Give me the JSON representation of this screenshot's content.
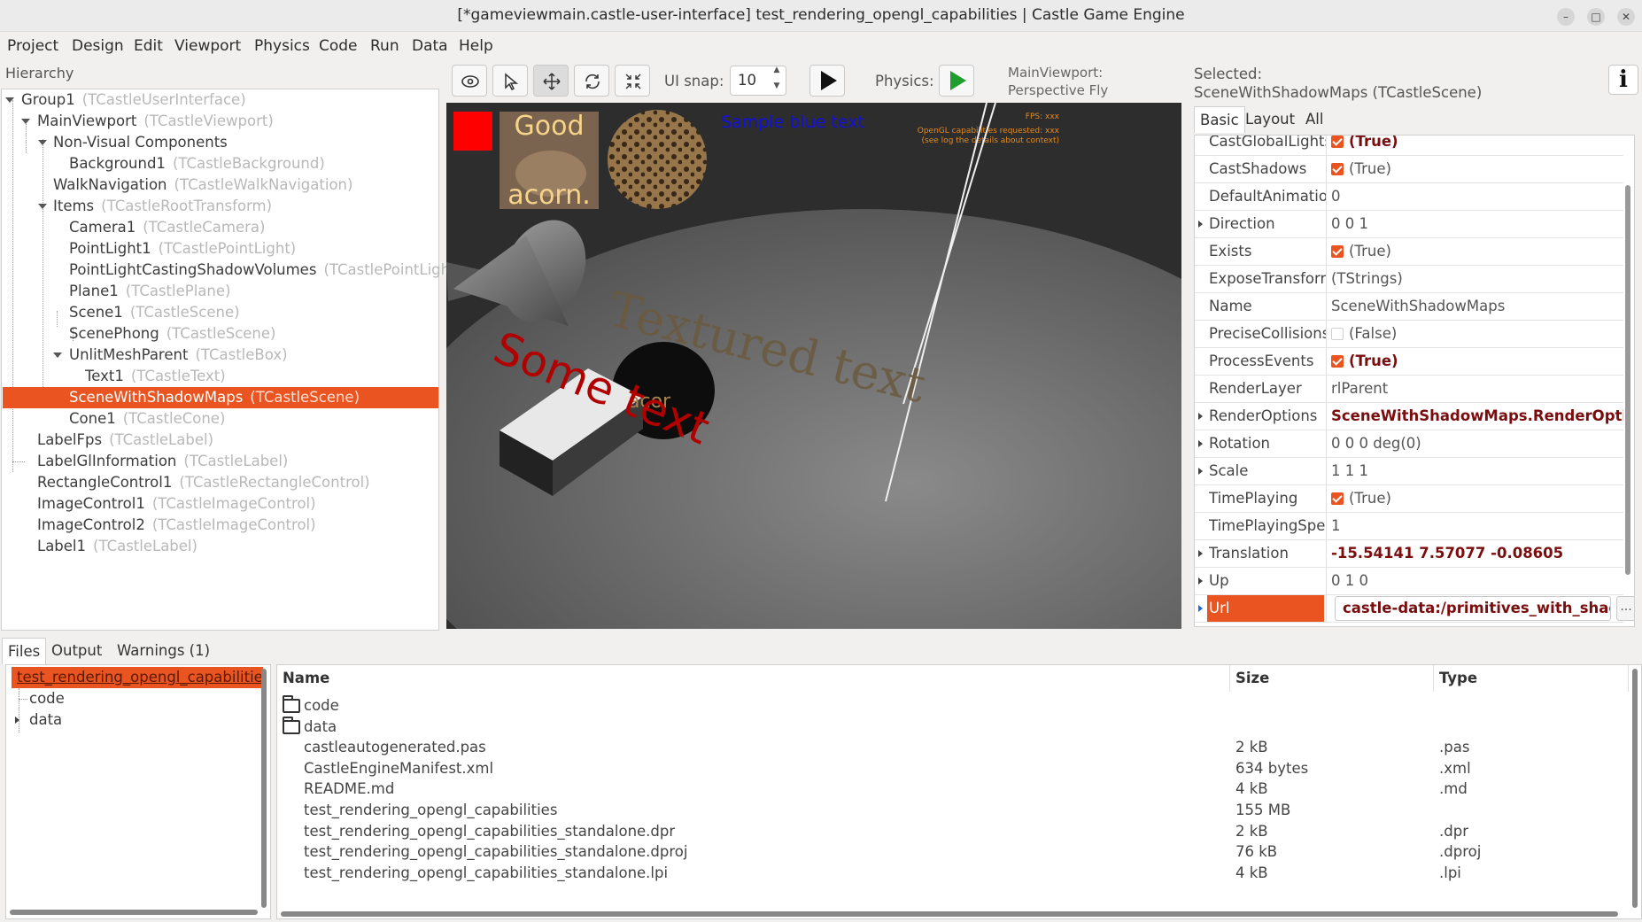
{
  "window": {
    "title": "[*gameviewmain.castle-user-interface] test_rendering_opengl_capabilities | Castle Game Engine"
  },
  "menu": [
    "Project",
    "Design",
    "Edit",
    "Viewport",
    "Physics",
    "Code",
    "Run",
    "Data",
    "Help"
  ],
  "hierarchy": {
    "label": "Hierarchy",
    "nodes": [
      {
        "name": "Group1",
        "cls": "(TCastleUserInterface)"
      },
      {
        "name": "MainViewport",
        "cls": "(TCastleViewport)"
      },
      {
        "name": "Non-Visual Components",
        "cls": ""
      },
      {
        "name": "Background1",
        "cls": "(TCastleBackground)"
      },
      {
        "name": "WalkNavigation",
        "cls": "(TCastleWalkNavigation)"
      },
      {
        "name": "Items",
        "cls": "(TCastleRootTransform)"
      },
      {
        "name": "Camera1",
        "cls": "(TCastleCamera)"
      },
      {
        "name": "PointLight1",
        "cls": "(TCastlePointLight)"
      },
      {
        "name": "PointLightCastingShadowVolumes",
        "cls": "(TCastlePointLigh"
      },
      {
        "name": "Plane1",
        "cls": "(TCastlePlane)"
      },
      {
        "name": "Scene1",
        "cls": "(TCastleScene)"
      },
      {
        "name": "ScenePhong",
        "cls": "(TCastleScene)"
      },
      {
        "name": "UnlitMeshParent",
        "cls": "(TCastleBox)"
      },
      {
        "name": "Text1",
        "cls": "(TCastleText)"
      },
      {
        "name": "SceneWithShadowMaps",
        "cls": "(TCastleScene)"
      },
      {
        "name": "Cone1",
        "cls": "(TCastleCone)"
      },
      {
        "name": "LabelFps",
        "cls": "(TCastleLabel)"
      },
      {
        "name": "LabelGlInformation",
        "cls": "(TCastleLabel)"
      },
      {
        "name": "RectangleControl1",
        "cls": "(TCastleRectangleControl)"
      },
      {
        "name": "ImageControl1",
        "cls": "(TCastleImageControl)"
      },
      {
        "name": "ImageControl2",
        "cls": "(TCastleImageControl)"
      },
      {
        "name": "Label1",
        "cls": "(TCastleLabel)"
      }
    ]
  },
  "toolbar": {
    "snap_label": "UI snap:",
    "snap_value": "10",
    "physics_label": "Physics:",
    "viewport_info": "MainViewport: Perspective Fly"
  },
  "viewport": {
    "good_text": "Good",
    "acorn_text": "acorn.",
    "blue_text": "Sample blue text",
    "fps_text": "FPS: xxx",
    "gl_text_1": "OpenGL capabilities requested: xxx",
    "gl_text_2": "(see log the details about context)",
    "textured_text": "Textured text",
    "some_text": "Some text",
    "acorn_small": "acor"
  },
  "inspector": {
    "selected_label": "Selected:",
    "selected_value": "SceneWithShadowMaps (TCastleScene)",
    "info_glyph": "i",
    "tabs": [
      "Basic",
      "Layout",
      "All"
    ],
    "properties": [
      {
        "name": "CastGlobalLights",
        "value": "(True)",
        "check": "on",
        "mod": true,
        "exp": false
      },
      {
        "name": "CastShadows",
        "value": "(True)",
        "check": "on",
        "mod": false,
        "exp": false
      },
      {
        "name": "DefaultAnimatio",
        "value": "0",
        "check": "",
        "mod": false,
        "exp": false
      },
      {
        "name": "Direction",
        "value": "0 0 1",
        "check": "",
        "mod": false,
        "exp": true
      },
      {
        "name": "Exists",
        "value": "(True)",
        "check": "on",
        "mod": false,
        "exp": false
      },
      {
        "name": "ExposeTransforr",
        "value": "(TStrings)",
        "check": "",
        "mod": false,
        "exp": false
      },
      {
        "name": "Name",
        "value": "SceneWithShadowMaps",
        "check": "",
        "mod": false,
        "exp": false
      },
      {
        "name": "PreciseCollisions",
        "value": "(False)",
        "check": "off",
        "mod": false,
        "exp": false
      },
      {
        "name": "ProcessEvents",
        "value": "(True)",
        "check": "on",
        "mod": true,
        "exp": false
      },
      {
        "name": "RenderLayer",
        "value": "rlParent",
        "check": "",
        "mod": false,
        "exp": false
      },
      {
        "name": "RenderOptions",
        "value": "SceneWithShadowMaps.RenderOptions",
        "check": "",
        "mod": true,
        "exp": true
      },
      {
        "name": "Rotation",
        "value": "0 0 0 deg(0)",
        "check": "",
        "mod": false,
        "exp": true
      },
      {
        "name": "Scale",
        "value": "1 1 1",
        "check": "",
        "mod": false,
        "exp": true
      },
      {
        "name": "TimePlaying",
        "value": "(True)",
        "check": "on",
        "mod": false,
        "exp": false
      },
      {
        "name": "TimePlayingSpee",
        "value": "1",
        "check": "",
        "mod": false,
        "exp": false
      },
      {
        "name": "Translation",
        "value": "-15.54141 7.57077 -0.08605",
        "check": "",
        "mod": true,
        "exp": true
      },
      {
        "name": "Up",
        "value": "0 1 0",
        "check": "",
        "mod": false,
        "exp": true
      }
    ],
    "url_name": "Url",
    "url_value": "castle-data:/primitives_with_shadow",
    "url_button": "..."
  },
  "bottom": {
    "tabs": [
      "Files",
      "Output",
      "Warnings (1)"
    ],
    "tree": {
      "root": "test_rendering_opengl_capabilitie",
      "children": [
        "code",
        "data"
      ]
    },
    "columns": [
      "Name",
      "Size",
      "Type"
    ],
    "files": [
      {
        "name": "code",
        "size": "",
        "type": "",
        "folder": true
      },
      {
        "name": "data",
        "size": "",
        "type": "",
        "folder": true
      },
      {
        "name": "castleautogenerated.pas",
        "size": "2 kB",
        "type": ".pas",
        "folder": false
      },
      {
        "name": "CastleEngineManifest.xml",
        "size": "634 bytes",
        "type": ".xml",
        "folder": false
      },
      {
        "name": "README.md",
        "size": "4 kB",
        "type": ".md",
        "folder": false
      },
      {
        "name": "test_rendering_opengl_capabilities",
        "size": "155 MB",
        "type": "",
        "folder": false
      },
      {
        "name": "test_rendering_opengl_capabilities_standalone.dpr",
        "size": "2 kB",
        "type": ".dpr",
        "folder": false
      },
      {
        "name": "test_rendering_opengl_capabilities_standalone.dproj",
        "size": "76 kB",
        "type": ".dproj",
        "folder": false
      },
      {
        "name": "test_rendering_opengl_capabilities_standalone.lpi",
        "size": "4 kB",
        "type": ".lpi",
        "folder": false
      }
    ]
  },
  "colors": {
    "accent": "#e95420",
    "modified_value": "#7a0d0d"
  }
}
